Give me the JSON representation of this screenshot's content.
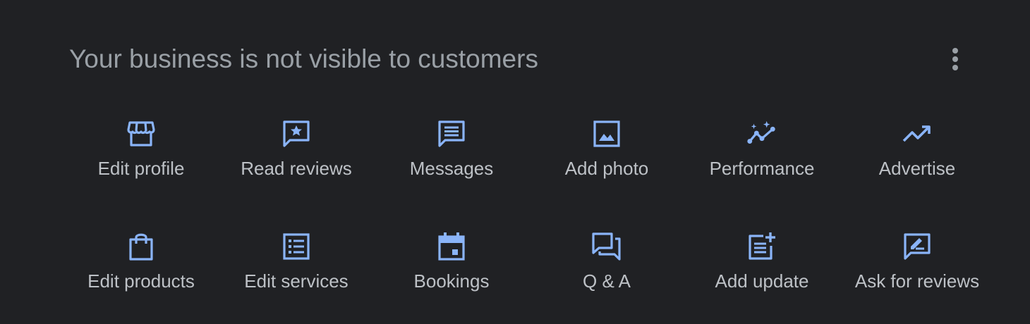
{
  "header": {
    "title": "Your business is not visible to customers",
    "more_icon": "more-vert-icon"
  },
  "colors": {
    "background": "#202124",
    "title_text": "#9aa0a6",
    "label_text": "#bdc1c6",
    "icon_accent": "#8ab4f8"
  },
  "actions": [
    {
      "label": "Edit profile",
      "icon": "storefront-icon"
    },
    {
      "label": "Read reviews",
      "icon": "reviews-icon"
    },
    {
      "label": "Messages",
      "icon": "message-icon"
    },
    {
      "label": "Add photo",
      "icon": "photo-icon"
    },
    {
      "label": "Performance",
      "icon": "insights-icon"
    },
    {
      "label": "Advertise",
      "icon": "trending-up-icon"
    },
    {
      "label": "Edit products",
      "icon": "shopping-bag-icon"
    },
    {
      "label": "Edit services",
      "icon": "list-icon"
    },
    {
      "label": "Bookings",
      "icon": "calendar-icon"
    },
    {
      "label": "Q & A",
      "icon": "forum-icon"
    },
    {
      "label": "Add update",
      "icon": "post-add-icon"
    },
    {
      "label": "Ask for reviews",
      "icon": "rate-review-icon"
    }
  ]
}
